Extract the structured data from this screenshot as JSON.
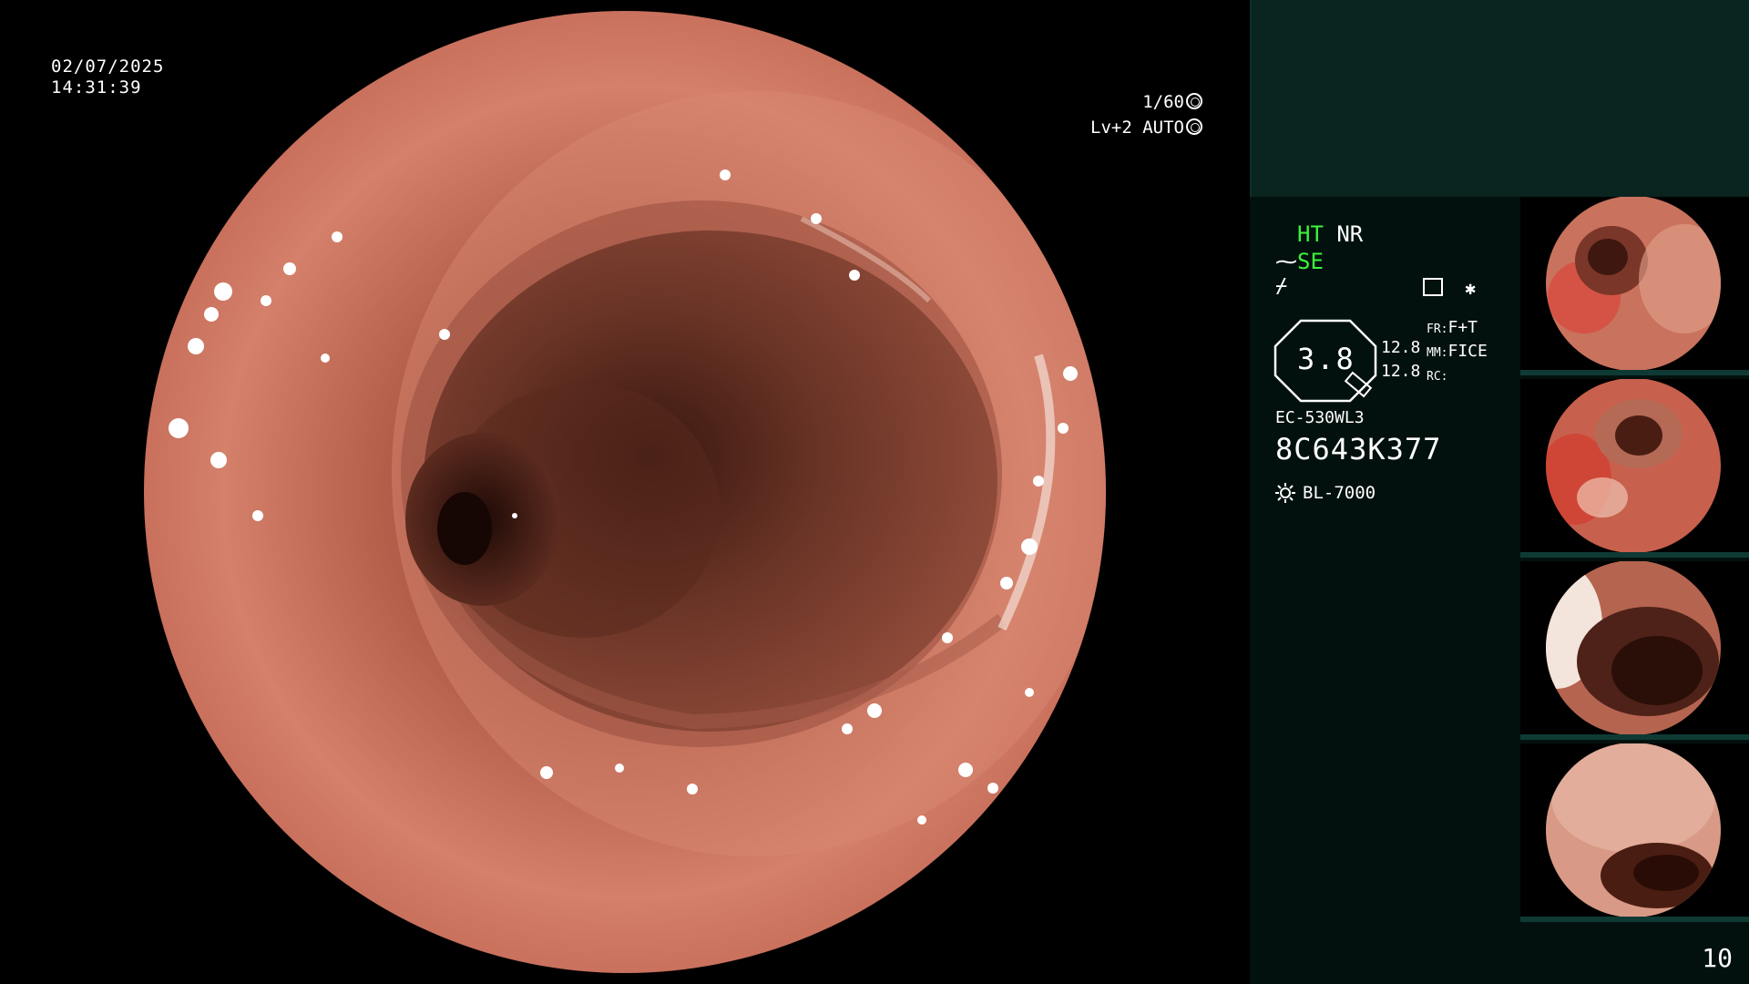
{
  "overlay": {
    "date": "02/07/2025",
    "time": "14:31:39",
    "shutter": "1/60",
    "level": "Lv+2 AUTO"
  },
  "side": {
    "ht": "HT",
    "nr": "NR",
    "se": "SE",
    "se_prefix": "⁓",
    "sym3": "⌿",
    "star": "✱",
    "zoom_value": "3.8",
    "zoom_num_1": "12.8",
    "zoom_num_2": "12.8",
    "fr_label": "FR:",
    "fr_value": "F+T",
    "mm_label": "MM:",
    "mm_value": "FICE",
    "rc_label": "RC:",
    "scope_model": "EC-530WL3",
    "serial": "8C643K377",
    "light_source": "BL-7000",
    "page_number": "10"
  },
  "thumbnails": [
    {
      "label": "capture-1"
    },
    {
      "label": "capture-2"
    },
    {
      "label": "capture-3"
    },
    {
      "label": "capture-4"
    }
  ],
  "colors": {
    "side_bg": "#03110e",
    "side_top_bg": "#0a2420",
    "accent_green": "#3cf23c",
    "tissue": "#c86a58"
  }
}
